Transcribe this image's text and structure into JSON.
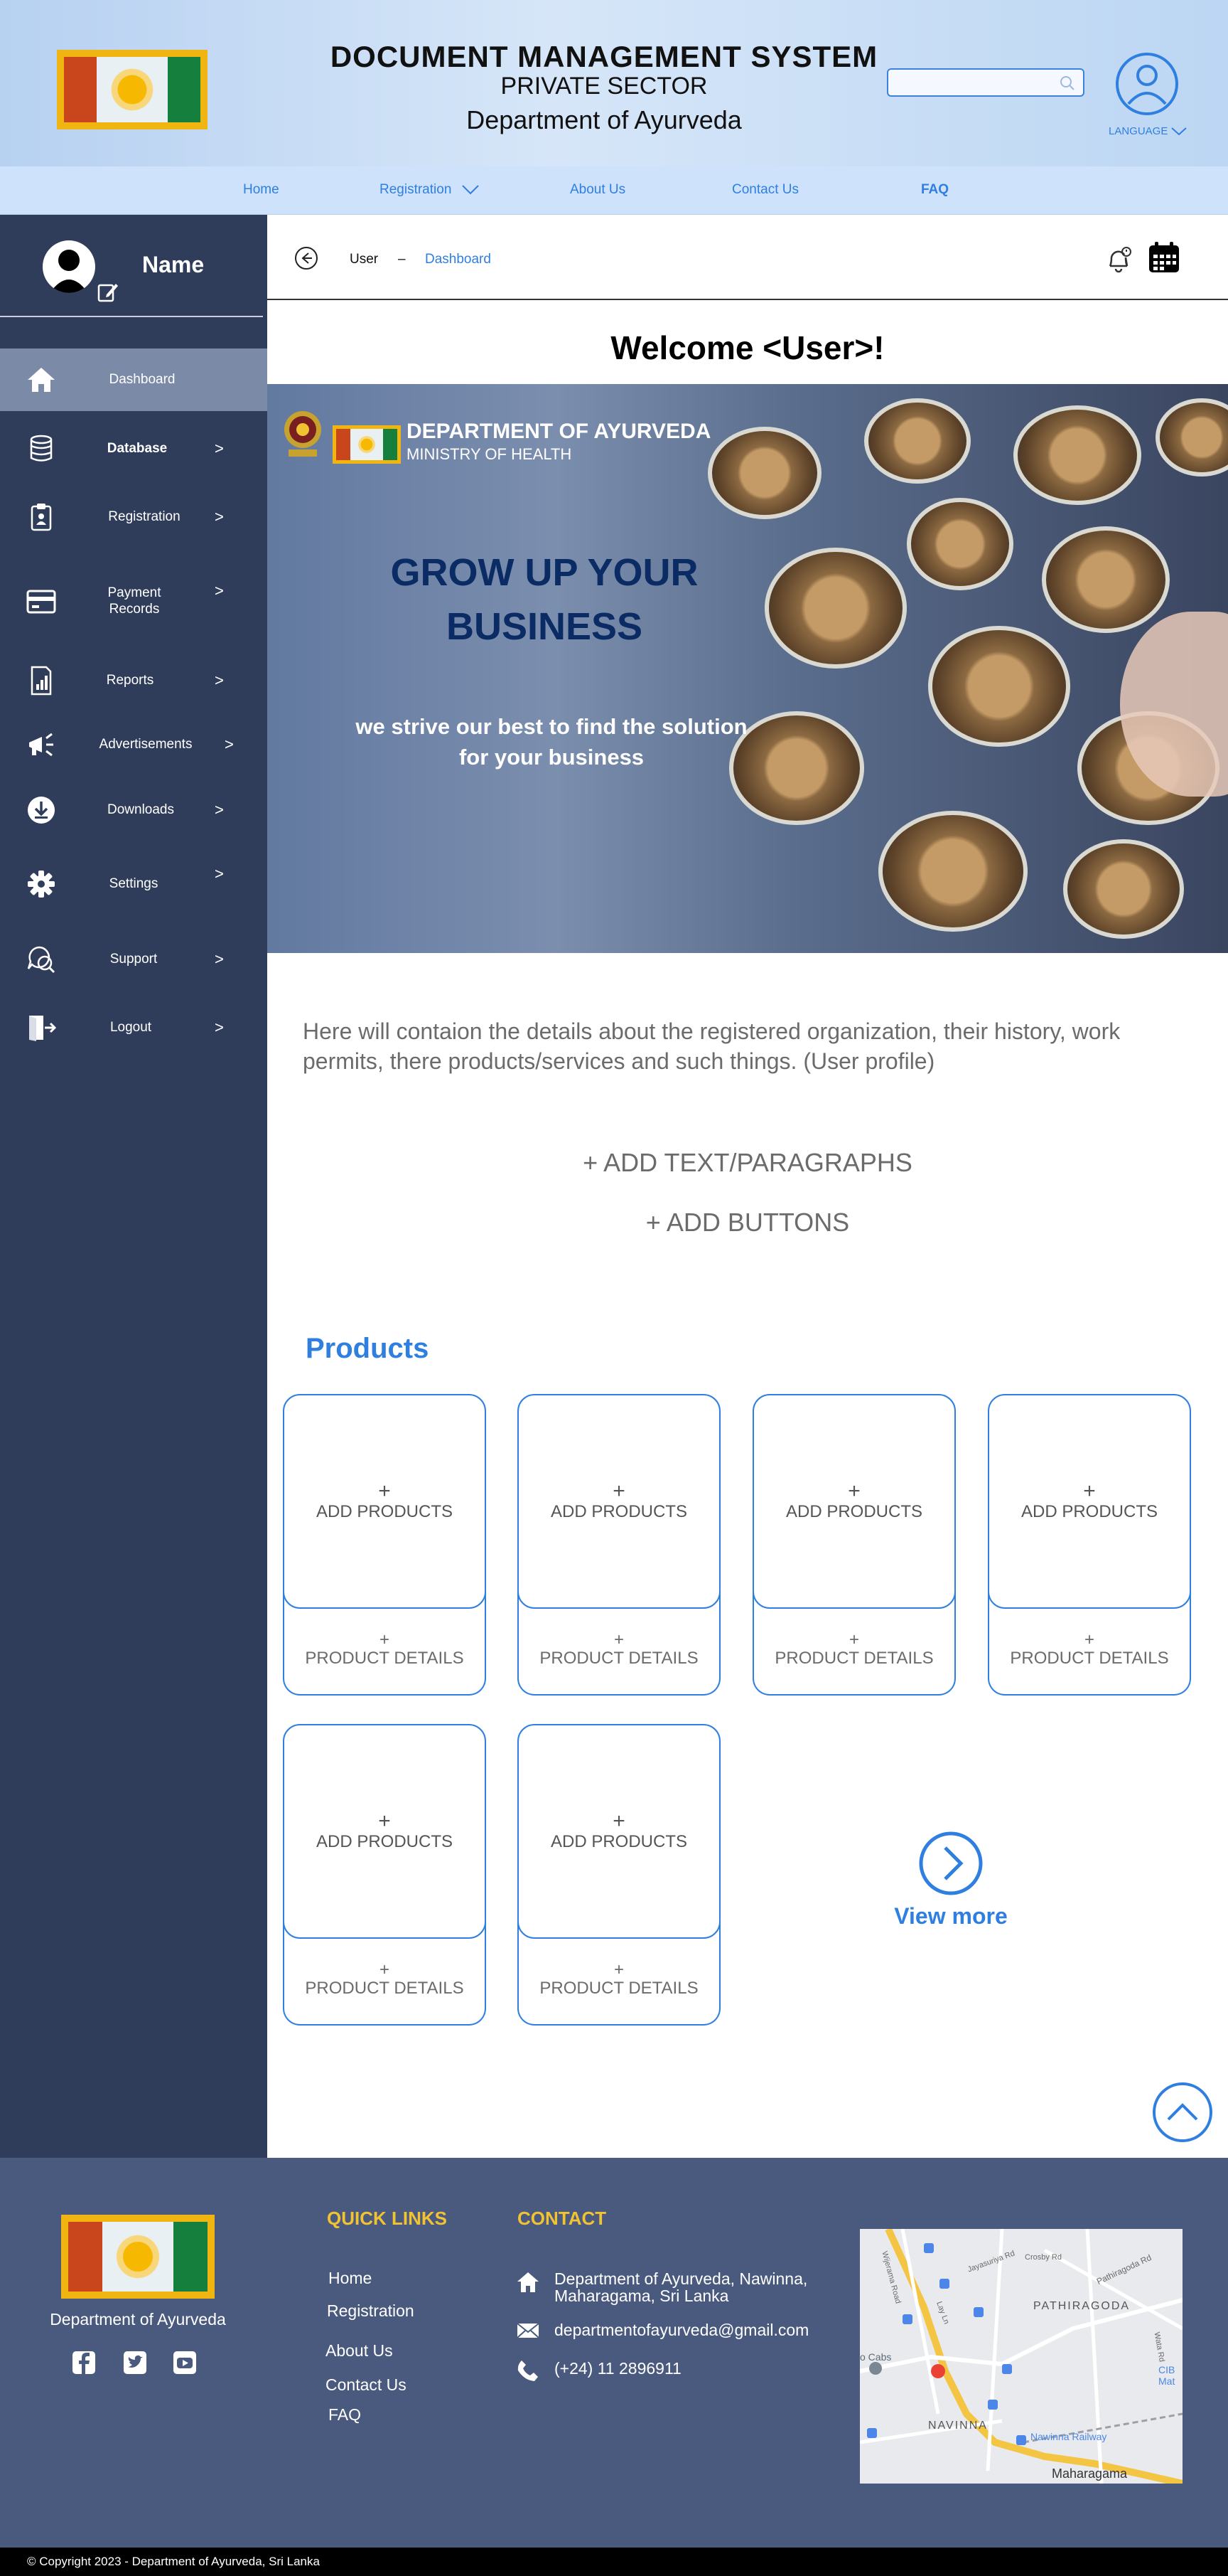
{
  "header": {
    "title": "DOCUMENT MANAGEMENT SYSTEM",
    "subtitle": "PRIVATE SECTOR",
    "department": "Department of Ayurveda",
    "search_placeholder": "",
    "language_label": "LANGUAGE"
  },
  "nav": {
    "home": "Home",
    "registration": "Registration",
    "about": "About Us",
    "contact": "Contact Us",
    "faq": "FAQ"
  },
  "sidebar": {
    "profile_name": "Name",
    "items": [
      {
        "label": "Dashboard",
        "icon": "home-icon"
      },
      {
        "label": "Database",
        "icon": "database-icon"
      },
      {
        "label": "Registration",
        "icon": "registration-icon"
      },
      {
        "label": "Payment Records",
        "icon": "credit-card-icon"
      },
      {
        "label": "Reports",
        "icon": "reports-icon"
      },
      {
        "label": "Advertisements",
        "icon": "megaphone-icon"
      },
      {
        "label": "Downloads",
        "icon": "download-icon"
      },
      {
        "label": "Settings",
        "icon": "gear-icon"
      },
      {
        "label": "Support",
        "icon": "support-icon"
      },
      {
        "label": "Logout",
        "icon": "logout-icon"
      }
    ],
    "chevron": ">"
  },
  "breadcrumb": {
    "user": "User",
    "sep": "–",
    "current": "Dashboard"
  },
  "welcome": "Welcome <User>!",
  "banner": {
    "dept": "DEPARTMENT OF AYURVEDA",
    "ministry": "MINISTRY OF HEALTH",
    "headline_1": "GROW UP YOUR",
    "headline_2": "BUSINESS",
    "tagline_1": "we strive our best to find the solution",
    "tagline_2": "for your business"
  },
  "profile_description": "Here will contaion the details about the registered organization, their history, work permits, there products/services and such things. (User profile)",
  "add_text": "+ ADD TEXT/PARAGRAPHS",
  "add_buttons": "+ ADD BUTTONS",
  "products": {
    "title": "Products",
    "plus": "+",
    "add_label": "ADD PRODUCTS",
    "details_label": "PRODUCT DETAILS",
    "view_more": "View more"
  },
  "footer": {
    "dept": "Department of Ayurveda",
    "quick_links_title": "QUICK LINKS",
    "contact_title": "CONTACT",
    "links": [
      "Home",
      "Registration",
      "About Us",
      "Contact Us",
      "FAQ"
    ],
    "address_1": "Department of Ayurveda, Nawinna,",
    "address_2": "Maharagama, Sri Lanka",
    "email": "departmentofayurveda@gmail.com",
    "phone": "(+24) 11 2896911",
    "copyright": "© Copyright 2023 - Department of Ayurveda, Sri Lanka"
  },
  "map": {
    "labels": [
      "Wijerama Road",
      "Jayasuriya Rd",
      "Crosby Rd",
      "Pathiragoda Rd",
      "PATHIRAGODA",
      "Lay Ln",
      "Wata Rd",
      "o Cabs",
      "CIB",
      "Mat",
      "NAVINNA",
      "Nawinna Railway",
      "Maharagama"
    ]
  },
  "colors": {
    "accent": "#2f7fe1",
    "sidebar": "#2f3d5a",
    "sidebar_active": "#7b8aa7",
    "footer": "#4a5a7e",
    "footer_heading": "#f1c232",
    "flag_saffron": "#c9461c",
    "flag_green": "#157f3d",
    "flag_border": "#f1b511"
  }
}
